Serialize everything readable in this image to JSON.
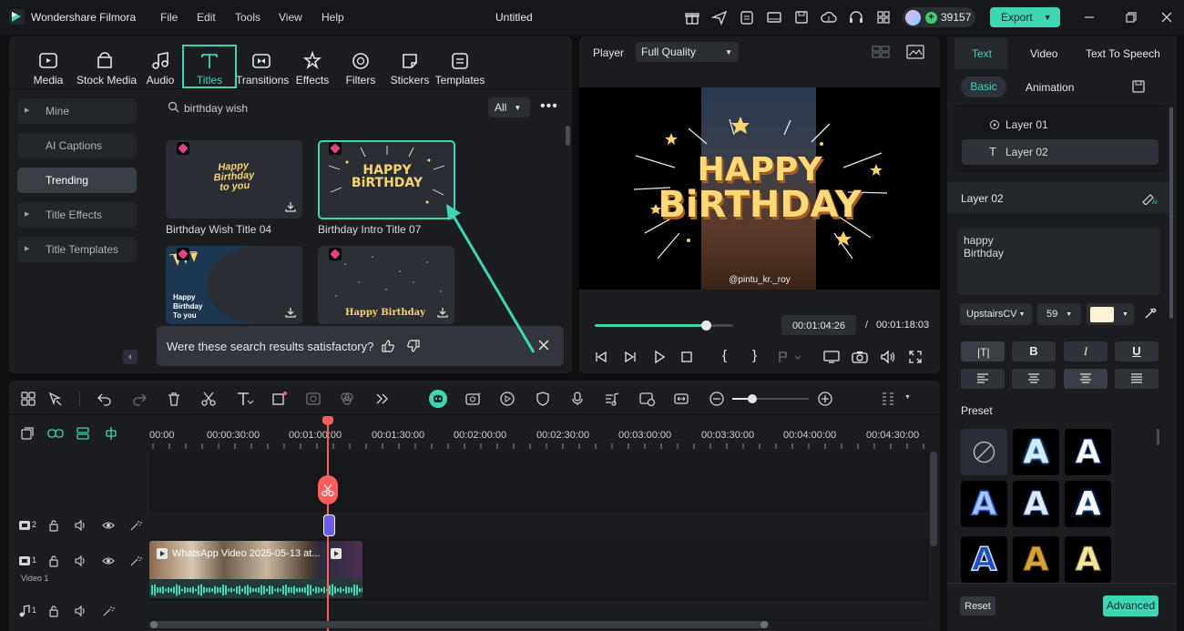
{
  "app": {
    "name": "Wondershare Filmora",
    "doc_title": "Untitled"
  },
  "menu": [
    "File",
    "Edit",
    "Tools",
    "View",
    "Help"
  ],
  "credits": "39157",
  "export_label": "Export",
  "toolbar": {
    "tools": [
      {
        "label": "Media",
        "icon": "media-icon"
      },
      {
        "label": "Stock Media",
        "icon": "stock-media-icon"
      },
      {
        "label": "Audio",
        "icon": "audio-icon"
      },
      {
        "label": "Titles",
        "icon": "titles-icon",
        "active": true
      },
      {
        "label": "Transitions",
        "icon": "transitions-icon"
      },
      {
        "label": "Effects",
        "icon": "effects-icon"
      },
      {
        "label": "Filters",
        "icon": "filters-icon"
      },
      {
        "label": "Stickers",
        "icon": "stickers-icon"
      },
      {
        "label": "Templates",
        "icon": "templates-icon"
      }
    ]
  },
  "sidebar": {
    "items": [
      {
        "label": "Mine",
        "arrow": true
      },
      {
        "label": "AI Captions",
        "arrow": false
      },
      {
        "label": "Trending",
        "arrow": false,
        "active": true
      },
      {
        "label": "Title Effects",
        "arrow": true
      },
      {
        "label": "Title Templates",
        "arrow": true
      }
    ]
  },
  "search": {
    "value": "birthday wish",
    "filter": "All"
  },
  "library": {
    "items": [
      {
        "label": "Birthday Wish Title 04",
        "art": "Happy Birthday to you"
      },
      {
        "label": "Birthday Intro Title 07",
        "art": "HAPPY BIRTHDAY"
      },
      {
        "label": "",
        "art": "Happy Birthday To you"
      },
      {
        "label": "",
        "art": "Happy Birthday"
      }
    ]
  },
  "feedback": {
    "question": "Were these search results satisfactory?"
  },
  "player": {
    "label": "Player",
    "quality": "Full Quality",
    "preview_line1": "HAPPY",
    "preview_line2": "BiRTHDAY",
    "watermark": "@pintu_kr._roy",
    "current_time": "00:01:04:26",
    "separator": "/",
    "total_time": "00:01:18:03",
    "progress": 0.8
  },
  "right_panel": {
    "tabs": [
      "Text",
      "Video",
      "Text To Speech"
    ],
    "subtabs": [
      "Basic",
      "Animation"
    ],
    "layers": [
      "Layer 01",
      "Layer 02"
    ],
    "selected_layer": "Layer 02",
    "text_value_line1": "happy",
    "text_value_line2": "Birthday",
    "font": "UpstairsCV",
    "font_size": "59",
    "font_color": "#fff3d6",
    "style_buttons": [
      "B",
      "I",
      "U"
    ],
    "preset_label": "Preset",
    "reset_label": "Reset",
    "advanced_label": "Advanced"
  },
  "timeline": {
    "ruler": [
      "00:00",
      "00:00:30:00",
      "00:01:00:00",
      "00:01:30:00",
      "00:02:00:00",
      "00:02:30:00",
      "00:03:00:00",
      "00:03:30:00",
      "00:04:00:00",
      "00:04:30:00"
    ],
    "tracks": [
      {
        "number": "2",
        "name": ""
      },
      {
        "number": "1",
        "name": "Video 1"
      },
      {
        "number": "1",
        "name": ""
      }
    ],
    "clip_label": "WhatsApp Video 2025-05-13 at..."
  },
  "colors": {
    "accent": "#3ed6b4",
    "playhead": "#ff5c5c",
    "gem": "#e73f85",
    "title_gold": "#f6d36b"
  }
}
